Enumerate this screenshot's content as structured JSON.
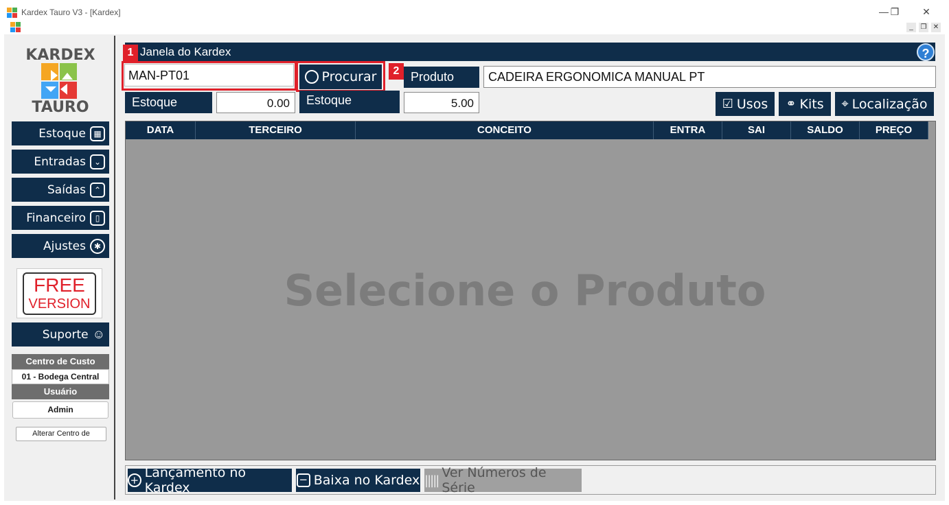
{
  "window": {
    "title": "Kardex Tauro V3 - [Kardex]",
    "minimize": "—",
    "restore": "❐",
    "close": "✕"
  },
  "mdi": {
    "minimize": "_",
    "restore": "❐",
    "close": "✕"
  },
  "logo": {
    "top": "KARDEX",
    "bottom": "TAURO"
  },
  "sidebar": {
    "items": [
      {
        "label": "Estoque",
        "icon": "stock-icon"
      },
      {
        "label": "Entradas",
        "icon": "inbox-icon"
      },
      {
        "label": "Saídas",
        "icon": "outbox-icon"
      },
      {
        "label": "Financeiro",
        "icon": "book-icon"
      },
      {
        "label": "Ajustes",
        "icon": "gear-icon"
      }
    ],
    "free_line1": "FREE",
    "free_line2": "VERSION",
    "suporte": "Suporte",
    "centro_custo_label": "Centro de Custo",
    "centro_custo_value": "01 - Bodega Central",
    "usuario_label": "Usuário",
    "usuario_value": "Admin",
    "alterar": "Alterar Centro de"
  },
  "header": {
    "title": "Janela do Kardex",
    "help": "?"
  },
  "badges": {
    "one": "1",
    "two": "2"
  },
  "search": {
    "code_value": "MAN-PT01",
    "procurar": "Procurar",
    "produto_label": "Produto",
    "produto_value": "CADEIRA ERGONOMICA MANUAL PT",
    "estoque_label_1": "Estoque",
    "estoque_value_1": "0.00",
    "estoque_label_2": "Estoque",
    "estoque_value_2": "5.00"
  },
  "actions": {
    "usos": "Usos",
    "kits": "Kits",
    "localizacao": "Localização"
  },
  "table": {
    "columns": [
      "DATA",
      "TERCEIRO",
      "CONCEITO",
      "ENTRA",
      "SAI",
      "SALDO",
      "PREÇO"
    ],
    "empty_message": "Selecione o Produto"
  },
  "bottom": {
    "lancamento": "Lançamento no Kardex",
    "baixa": "Baixa no Kardex",
    "series": "Ver Números de Série"
  },
  "colors": {
    "navy": "#0f2d4a",
    "red": "#e0202a",
    "help_blue": "#2f7fd4",
    "grid_gray": "#999999"
  }
}
